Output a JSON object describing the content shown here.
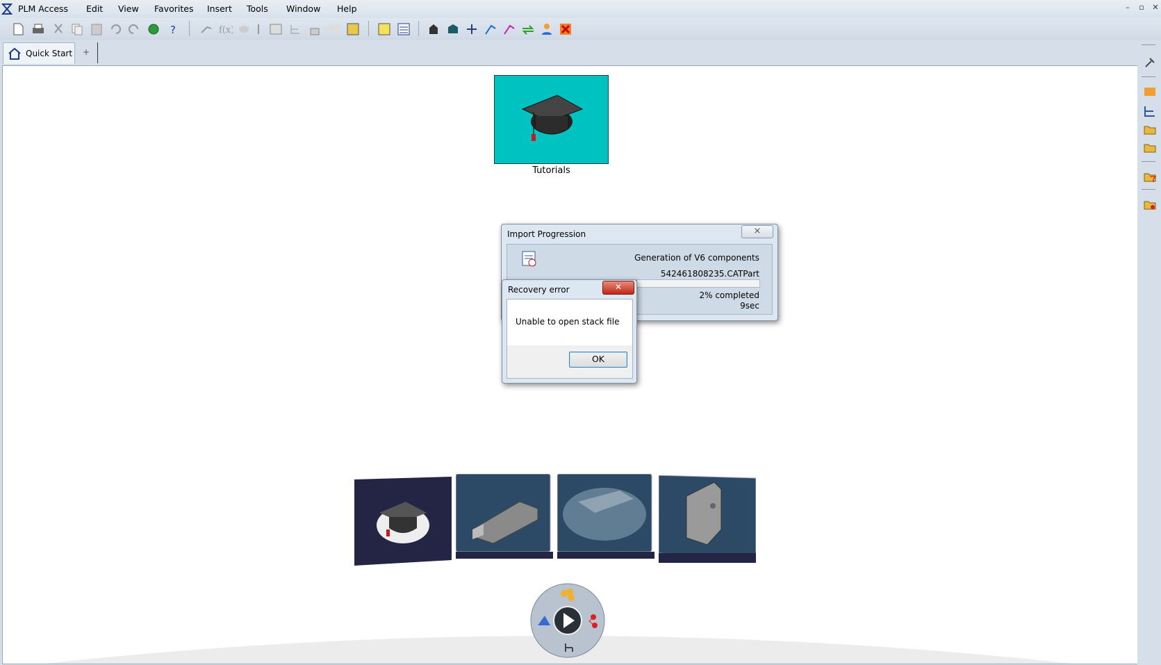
{
  "menubar": {
    "items": [
      "PLM Access",
      "Edit",
      "View",
      "Favorites",
      "Insert",
      "Tools",
      "Window",
      "Help"
    ]
  },
  "window_controls": {
    "minimize": "–",
    "restore": "▫",
    "close": "✕"
  },
  "tabs": {
    "quick_start": "Quick Start",
    "add": "+"
  },
  "welcome": {
    "tutorials_label": "Tutorials"
  },
  "import_dialog": {
    "title": "Import Progression",
    "close_label": "⨯",
    "status": "Generation of V6 components",
    "file": "542461808235.CATPart",
    "progress_percent": 2,
    "percent_label": "2% completed",
    "elapsed": "9sec"
  },
  "error_dialog": {
    "title": "Recovery error",
    "close_label": "✕",
    "message": "Unable to open stack file",
    "ok_label": "OK"
  },
  "carousel": {
    "cards": [
      "graduation-cap",
      "usb-drive",
      "disc-part",
      "bracket-part"
    ]
  },
  "colors": {
    "tile_bg": "#00c2c0",
    "card_bg": "#2a4a66",
    "ok_border": "#3c7fb1",
    "close_red": "#c1281a"
  }
}
